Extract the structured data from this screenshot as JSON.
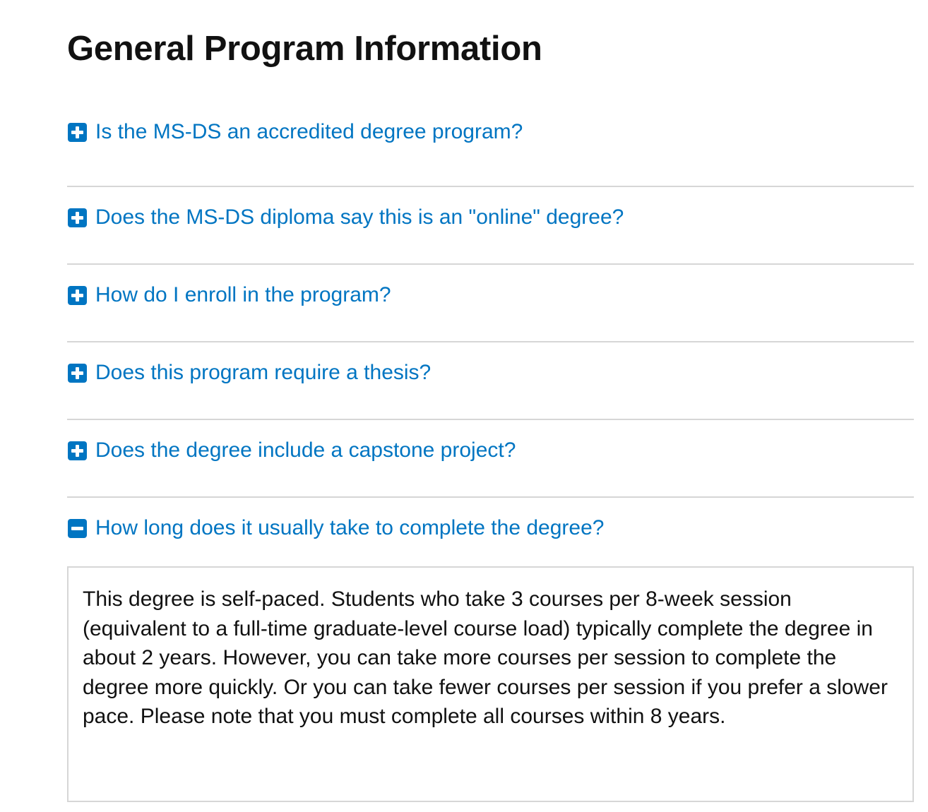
{
  "page": {
    "title": "General Program Information"
  },
  "colors": {
    "accent": "#0075c2",
    "text": "#111111",
    "divider": "#d6d6d6"
  },
  "faq": {
    "items": [
      {
        "question": "Is the MS-DS an accredited degree program?",
        "icon": "plus-square-icon",
        "expanded": false
      },
      {
        "question": "Does the MS-DS diploma say this is an \"online\" degree?",
        "icon": "plus-square-icon",
        "expanded": false
      },
      {
        "question": "How do I enroll in the program?",
        "icon": "plus-square-icon",
        "expanded": false
      },
      {
        "question": "Does this program require a thesis?",
        "icon": "plus-square-icon",
        "expanded": false
      },
      {
        "question": "Does the degree include a capstone project?",
        "icon": "plus-square-icon",
        "expanded": false
      },
      {
        "question": "How long does it usually take to complete the degree?",
        "icon": "minus-square-icon",
        "expanded": true,
        "answer": "This degree is self-paced. Students who take 3 courses per 8-week session (equivalent to a full-time graduate-level course load) typically complete the degree in about 2 years. However, you can take more courses per session to complete the degree more quickly. Or you can take fewer courses per session if you prefer a slower pace. Please note that you must complete all courses within 8 years."
      }
    ]
  }
}
